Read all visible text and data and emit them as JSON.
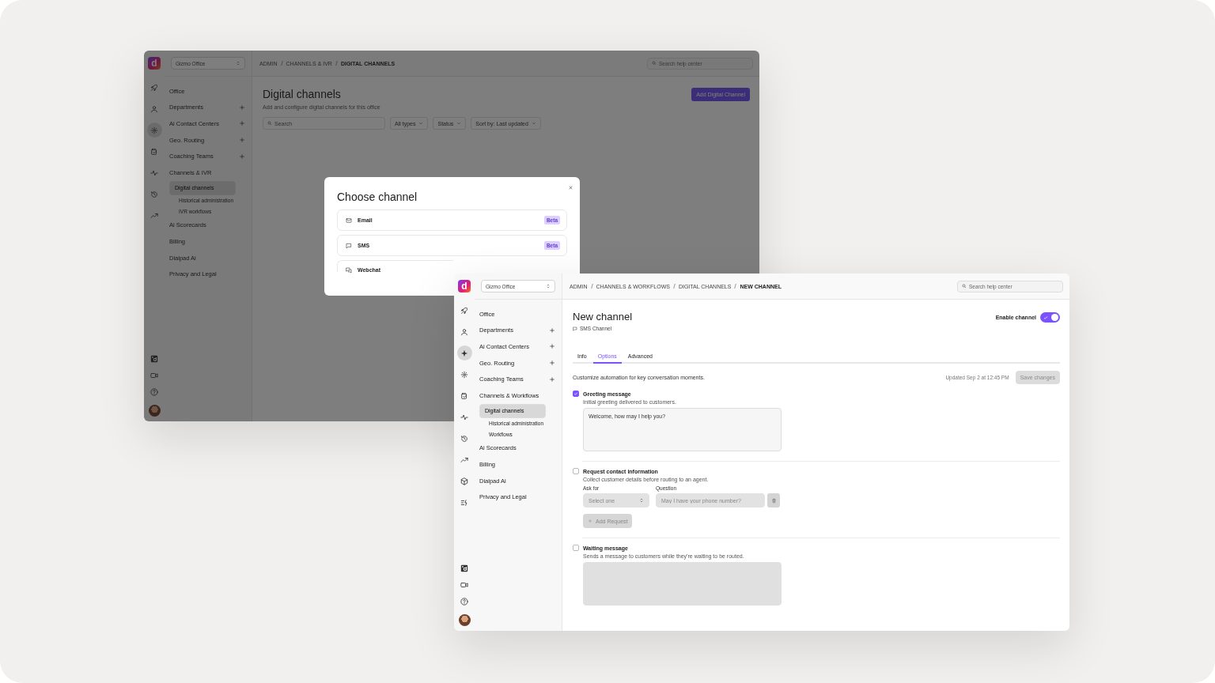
{
  "windows": [
    {
      "kind": "list",
      "logo": "d",
      "office": "Gizmo Office",
      "breadcrumb": [
        {
          "label": "ADMIN",
          "current": false
        },
        {
          "label": "CHANNELS & IVR",
          "current": false
        },
        {
          "label": "DIGITAL CHANNELS",
          "current": true
        }
      ],
      "help_search": {
        "placeholder": "Search help center"
      },
      "rail": [
        {
          "kind": "rocket",
          "selected": false
        },
        {
          "kind": "person",
          "selected": false
        },
        {
          "kind": "gear",
          "selected": true
        },
        {
          "kind": "calendar",
          "selected": false
        },
        {
          "kind": "pulse",
          "selected": false
        },
        {
          "kind": "history",
          "selected": false
        },
        {
          "kind": "trend",
          "selected": false
        }
      ],
      "rail_bottom": [
        {
          "kind": "app"
        },
        {
          "kind": "video"
        },
        {
          "kind": "help"
        },
        {
          "kind": "avatar"
        }
      ],
      "nav": [
        {
          "label": "Office",
          "add": false,
          "selected": false
        },
        {
          "label": "Departments",
          "add": true,
          "selected": false
        },
        {
          "label": "Ai Contact Centers",
          "add": true,
          "selected": false
        },
        {
          "label": "Geo. Routing",
          "add": true,
          "selected": false
        },
        {
          "label": "Coaching Teams",
          "add": true,
          "selected": false
        },
        {
          "label": "Channels & IVR",
          "add": false,
          "selected": false,
          "children": [
            {
              "label": "Digital channels",
              "selected": true
            },
            {
              "label": "Historical administration",
              "selected": false
            },
            {
              "label": "IVR workflows",
              "selected": false
            }
          ]
        },
        {
          "label": "Ai Scorecards",
          "add": false,
          "selected": false
        },
        {
          "label": "Billing",
          "add": false,
          "selected": false
        },
        {
          "label": "Dialpad Ai",
          "add": false,
          "selected": false
        },
        {
          "label": "Privacy and Legal",
          "add": false,
          "selected": false
        }
      ],
      "page": {
        "title": "Digital channels",
        "subtitle": "Add and configure digital channels for this office",
        "add_button": "Add Digital Channel",
        "search": {
          "placeholder": "Search"
        },
        "filters": [
          "All types",
          "Status",
          "Sort by: Last updated"
        ]
      },
      "modal": {
        "title": "Choose channel",
        "options": [
          {
            "kind": "mail",
            "label": "Email",
            "badge": "Beta"
          },
          {
            "kind": "chat",
            "label": "SMS",
            "badge": "Beta"
          },
          {
            "kind": "chats",
            "label": "Webchat"
          }
        ]
      }
    },
    {
      "kind": "editor",
      "logo": "d",
      "office": "Gizmo Office",
      "breadcrumb": [
        {
          "label": "ADMIN",
          "current": false
        },
        {
          "label": "CHANNELS & WORKFLOWS",
          "current": false
        },
        {
          "label": "DIGITAL CHANNELS",
          "current": false
        },
        {
          "label": "NEW CHANNEL",
          "current": true
        }
      ],
      "help_search": {
        "placeholder": "Search help center"
      },
      "rail": [
        {
          "kind": "rocket",
          "selected": false
        },
        {
          "kind": "person",
          "selected": false
        },
        {
          "kind": "sparkle",
          "selected": true
        },
        {
          "kind": "gear",
          "selected": false
        },
        {
          "kind": "calendar",
          "selected": false
        },
        {
          "kind": "pulse",
          "selected": false
        },
        {
          "kind": "history",
          "selected": false
        },
        {
          "kind": "trend",
          "selected": false
        },
        {
          "kind": "cube",
          "selected": false
        },
        {
          "kind": "listbolt",
          "selected": false
        }
      ],
      "rail_bottom": [
        {
          "kind": "app"
        },
        {
          "kind": "video"
        },
        {
          "kind": "help"
        },
        {
          "kind": "avatar"
        }
      ],
      "nav": [
        {
          "label": "Office",
          "add": false,
          "selected": false
        },
        {
          "label": "Departments",
          "add": true,
          "selected": false
        },
        {
          "label": "Ai Contact Centers",
          "add": true,
          "selected": false
        },
        {
          "label": "Geo. Routing",
          "add": true,
          "selected": false
        },
        {
          "label": "Coaching Teams",
          "add": true,
          "selected": false
        },
        {
          "label": "Channels & Workflows",
          "add": false,
          "selected": false,
          "children": [
            {
              "label": "Digital channels",
              "selected": true
            },
            {
              "label": "Historical administration",
              "selected": false
            },
            {
              "label": "Workflows",
              "selected": false
            }
          ]
        },
        {
          "label": "Ai Scorecards",
          "add": false,
          "selected": false
        },
        {
          "label": "Billing",
          "add": false,
          "selected": false
        },
        {
          "label": "Dialpad Ai",
          "add": false,
          "selected": false
        },
        {
          "label": "Privacy and Legal",
          "add": false,
          "selected": false
        }
      ],
      "page": {
        "title": "New channel",
        "channel_type": "SMS Channel",
        "enable": {
          "label": "Enable channel",
          "on": true
        },
        "tabs": [
          {
            "label": "Info",
            "selected": false
          },
          {
            "label": "Options",
            "selected": true
          },
          {
            "label": "Advanced",
            "selected": false
          }
        ],
        "description": "Customize automation for key conversation moments.",
        "updated": "Updated Sep 2 at 12:45 PM",
        "save": {
          "label": "Save changes",
          "disabled": true
        },
        "sections": [
          {
            "kind": "message",
            "title": "Greeting message",
            "checked": true,
            "description": "Initial greeting delivered to customers.",
            "value": "Welcome, how may I help you?"
          },
          {
            "kind": "request",
            "title": "Request contact information",
            "checked": false,
            "description": "Collect customer details before routing to an agent.",
            "ask_label": "Ask for",
            "select_placeholder": "Select one",
            "question_label": "Question",
            "question_placeholder": "May I have your phone number?",
            "add_button": "Add Request"
          },
          {
            "kind": "message",
            "title": "Waiting message",
            "checked": false,
            "description": "Sends a message to customers while they're waiting to be routed."
          }
        ]
      }
    }
  ]
}
